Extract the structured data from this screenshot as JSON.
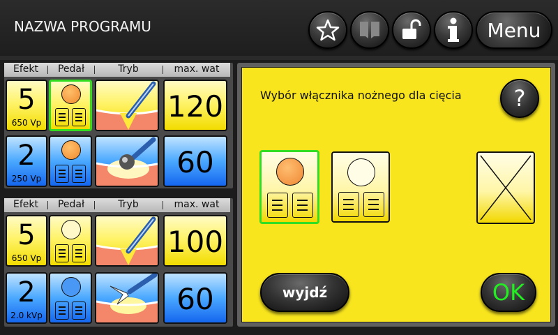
{
  "header": {
    "program_name": "NAZWA PROGRAMU",
    "icons": [
      "star-icon",
      "book-icon",
      "unlock-icon",
      "info-icon"
    ],
    "menu_label": "Menu"
  },
  "columns": [
    "Efekt",
    "Pedał",
    "Tryb",
    "max. wat"
  ],
  "groups": [
    {
      "rows": [
        {
          "color": "yellow",
          "effect": "5",
          "effect_sub": "650 Vp",
          "pedal": "active",
          "selected_pedal": true,
          "mode": "cut-blade",
          "watt": "120"
        },
        {
          "color": "blue",
          "effect": "2",
          "effect_sub": "250 Vp",
          "pedal": "active",
          "selected_pedal": false,
          "mode": "coag-ball",
          "watt": "60"
        }
      ]
    },
    {
      "rows": [
        {
          "color": "yellow",
          "effect": "5",
          "effect_sub": "650 Vp",
          "pedal": "inactive",
          "selected_pedal": false,
          "mode": "cut-blade",
          "watt": "100"
        },
        {
          "color": "blue",
          "effect": "2",
          "effect_sub": "2.0 kVp",
          "pedal": "inactive",
          "selected_pedal": false,
          "mode": "spray-coag",
          "watt": "60"
        }
      ]
    }
  ],
  "dialog": {
    "title": "Wybór włącznika nożnego dla cięcia",
    "help_label": "?",
    "options": [
      "pedal-active",
      "pedal-inactive",
      "none"
    ],
    "exit_label": "wyjdź",
    "ok_label": "OK"
  },
  "colors": {
    "yellow": "#fff36a",
    "blue": "#4aa8ff",
    "panel": "#f8e51e",
    "selected": "#33dd22",
    "ok_text": "#22ee22"
  }
}
